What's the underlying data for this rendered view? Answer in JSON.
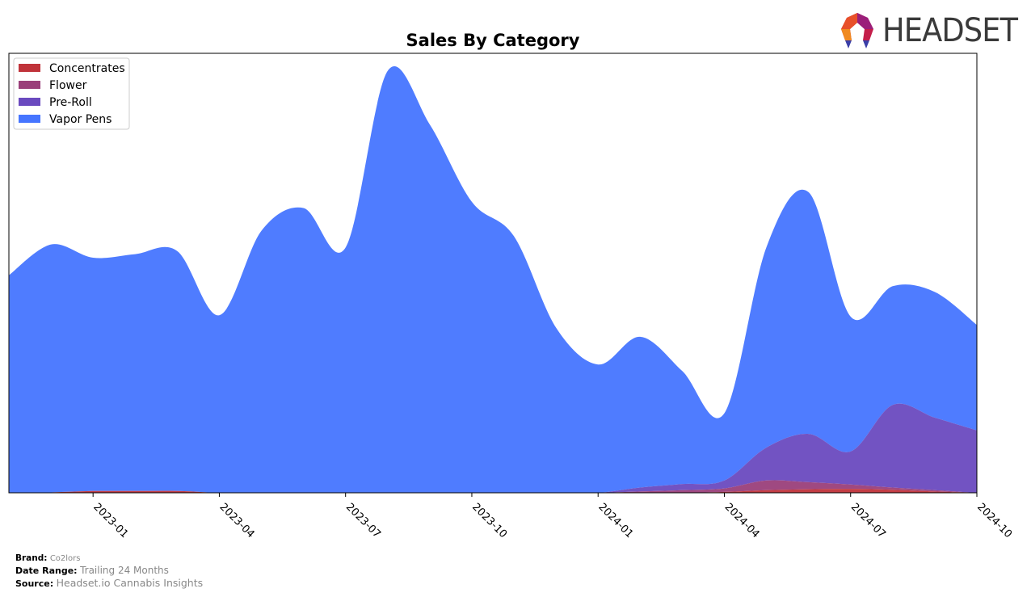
{
  "brand_logo": {
    "text": "HEADSET",
    "icon": "headset-logo-icon"
  },
  "footer": {
    "brand_label": "Brand:",
    "brand_value": "Co2lors",
    "range_label": "Date Range:",
    "range_value": "Trailing 24 Months",
    "source_label": "Source:",
    "source_value": "Headset.io Cannabis Insights"
  },
  "chart_data": {
    "type": "area",
    "title": "Sales By Category",
    "xlabel": "",
    "ylabel": "",
    "stacked": true,
    "smoothed": true,
    "grid": false,
    "legend_position": "top-left",
    "y_ticks_visible": false,
    "ylim": [
      0,
      100
    ],
    "x": [
      "2022-11",
      "2022-12",
      "2023-01",
      "2023-02",
      "2023-03",
      "2023-04",
      "2023-05",
      "2023-06",
      "2023-07",
      "2023-08",
      "2023-09",
      "2023-10",
      "2023-11",
      "2023-12",
      "2024-01",
      "2024-02",
      "2024-03",
      "2024-04",
      "2024-05",
      "2024-06",
      "2024-07",
      "2024-08",
      "2024-09",
      "2024-10"
    ],
    "x_tick_labels": [
      "2023-01",
      "2023-04",
      "2023-07",
      "2023-10",
      "2024-01",
      "2024-04",
      "2024-07",
      "2024-10"
    ],
    "x_tick_values": [
      "2023-01",
      "2023-04",
      "2023-07",
      "2023-10",
      "2024-01",
      "2024-04",
      "2024-07",
      "2024-10"
    ],
    "series": [
      {
        "name": "Concentrates",
        "color": "#c0333a",
        "values": [
          0,
          0.1,
          0.4,
          0.4,
          0.4,
          0,
          0,
          0,
          0,
          0,
          0,
          0,
          0,
          0,
          0,
          0,
          0,
          0.2,
          0.6,
          0.8,
          0.9,
          0.7,
          0.3,
          0
        ]
      },
      {
        "name": "Flower",
        "color": "#9a3f7a",
        "values": [
          0,
          0,
          0,
          0,
          0,
          0,
          0,
          0,
          0,
          0,
          0,
          0,
          0,
          0,
          0,
          0.3,
          0.6,
          0.8,
          2.2,
          1.6,
          1.0,
          0.5,
          0.3,
          0
        ]
      },
      {
        "name": "Pre-Roll",
        "color": "#6a4abf",
        "values": [
          0,
          0,
          0,
          0,
          0,
          0,
          0,
          0,
          0,
          0,
          0,
          0,
          0,
          0,
          0,
          0.9,
          1.4,
          1.8,
          7.5,
          11.0,
          7.5,
          18.8,
          16.5,
          14.2
        ]
      },
      {
        "name": "Vapor Pens",
        "color": "#4675ff",
        "values": [
          49.5,
          56.4,
          53.1,
          53.9,
          54.6,
          40.4,
          59.6,
          64.8,
          55.8,
          96.0,
          83.8,
          66.2,
          58.4,
          37.6,
          29.2,
          34.3,
          25.7,
          15.3,
          45.6,
          55.0,
          30.7,
          27.0,
          28.6,
          24.0
        ]
      }
    ]
  }
}
